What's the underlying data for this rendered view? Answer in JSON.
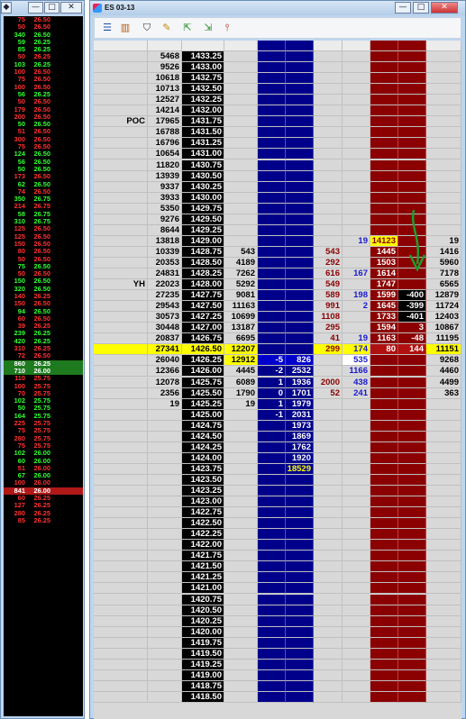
{
  "left_window": {
    "buttons": [
      "—",
      "□",
      "✕"
    ],
    "trades": [
      {
        "q": "75",
        "p": "26.50",
        "c": "#ff3030"
      },
      {
        "q": "50",
        "p": "26.50",
        "c": "#ff3030"
      },
      {
        "q": "340",
        "p": "26.50",
        "c": "#30ff30"
      },
      {
        "q": "59",
        "p": "26.25",
        "c": "#30ff30"
      },
      {
        "q": "85",
        "p": "26.25",
        "c": "#30ff30"
      },
      {
        "q": "50",
        "p": "26.25",
        "c": "#ff3030"
      },
      {
        "q": "103",
        "p": "26.25",
        "c": "#30ff30"
      },
      {
        "q": "100",
        "p": "26.50",
        "c": "#ff3030"
      },
      {
        "q": "75",
        "p": "26.50",
        "c": "#ff3030"
      },
      {
        "q": "100",
        "p": "26.50",
        "c": "#ff3030"
      },
      {
        "q": "56",
        "p": "26.25",
        "c": "#30ff30"
      },
      {
        "q": "50",
        "p": "26.50",
        "c": "#ff3030"
      },
      {
        "q": "179",
        "p": "26.50",
        "c": "#ff3030"
      },
      {
        "q": "200",
        "p": "26.50",
        "c": "#ff3030"
      },
      {
        "q": "50",
        "p": "26.50",
        "c": "#30ff30"
      },
      {
        "q": "51",
        "p": "26.50",
        "c": "#ff3030"
      },
      {
        "q": "300",
        "p": "26.50",
        "c": "#ff3030"
      },
      {
        "q": "75",
        "p": "26.50",
        "c": "#ff3030"
      },
      {
        "q": "124",
        "p": "26.50",
        "c": "#30ff30"
      },
      {
        "q": "56",
        "p": "26.50",
        "c": "#30ff30"
      },
      {
        "q": "50",
        "p": "26.50",
        "c": "#30ff30"
      },
      {
        "q": "173",
        "p": "26.50",
        "c": "#ff3030"
      },
      {
        "q": "62",
        "p": "26.50",
        "c": "#30ff30"
      },
      {
        "q": "74",
        "p": "26.50",
        "c": "#ff3030"
      },
      {
        "q": "350",
        "p": "26.75",
        "c": "#30ff30"
      },
      {
        "q": "214",
        "p": "26.75",
        "c": "#ff3030"
      },
      {
        "q": "58",
        "p": "26.75",
        "c": "#30ff30"
      },
      {
        "q": "310",
        "p": "26.75",
        "c": "#30ff30"
      },
      {
        "q": "125",
        "p": "26.50",
        "c": "#ff3030"
      },
      {
        "q": "125",
        "p": "26.50",
        "c": "#ff3030"
      },
      {
        "q": "150",
        "p": "26.50",
        "c": "#ff3030"
      },
      {
        "q": "80",
        "p": "26.50",
        "c": "#ff3030"
      },
      {
        "q": "50",
        "p": "26.50",
        "c": "#ff3030"
      },
      {
        "q": "75",
        "p": "26.50",
        "c": "#30ff30"
      },
      {
        "q": "50",
        "p": "26.50",
        "c": "#ff3030"
      },
      {
        "q": "150",
        "p": "26.50",
        "c": "#30ff30"
      },
      {
        "q": "320",
        "p": "26.50",
        "c": "#30ff30"
      },
      {
        "q": "140",
        "p": "26.25",
        "c": "#ff3030"
      },
      {
        "q": "150",
        "p": "26.50",
        "c": "#ff3030"
      },
      {
        "q": "94",
        "p": "26.50",
        "c": "#30ff30"
      },
      {
        "q": "60",
        "p": "26.50",
        "c": "#ff3030"
      },
      {
        "q": "39",
        "p": "26.25",
        "c": "#ff3030"
      },
      {
        "q": "239",
        "p": "26.25",
        "c": "#30ff30"
      },
      {
        "q": "420",
        "p": "26.25",
        "c": "#30ff30"
      },
      {
        "q": "310",
        "p": "26.25",
        "c": "#ff3030"
      },
      {
        "q": "72",
        "p": "26.50",
        "c": "#ff3030"
      },
      {
        "q": "860",
        "p": "26.25",
        "c": "#ffffff",
        "bg": "#1e7a1e"
      },
      {
        "q": "710",
        "p": "26.00",
        "c": "#ffffff",
        "bg": "#1e7a1e"
      },
      {
        "q": "110",
        "p": "25.75",
        "c": "#ff3030"
      },
      {
        "q": "100",
        "p": "25.75",
        "c": "#ff3030"
      },
      {
        "q": "70",
        "p": "25.75",
        "c": "#ff3030"
      },
      {
        "q": "102",
        "p": "25.75",
        "c": "#30ff30"
      },
      {
        "q": "50",
        "p": "25.75",
        "c": "#30ff30"
      },
      {
        "q": "164",
        "p": "25.75",
        "c": "#30ff30"
      },
      {
        "q": "225",
        "p": "25.75",
        "c": "#ff3030"
      },
      {
        "q": "75",
        "p": "25.75",
        "c": "#ff3030"
      },
      {
        "q": "280",
        "p": "25.75",
        "c": "#ff3030"
      },
      {
        "q": "75",
        "p": "25.75",
        "c": "#ff3030"
      },
      {
        "q": "102",
        "p": "26.00",
        "c": "#30ff30"
      },
      {
        "q": "60",
        "p": "26.00",
        "c": "#30ff30"
      },
      {
        "q": "51",
        "p": "26.00",
        "c": "#ff3030"
      },
      {
        "q": "67",
        "p": "26.00",
        "c": "#30ff30"
      },
      {
        "q": "100",
        "p": "26.00",
        "c": "#ff3030"
      },
      {
        "q": "841",
        "p": "26.00",
        "c": "#ffffff",
        "bg": "#b01818"
      },
      {
        "q": "60",
        "p": "26.25",
        "c": "#ff3030"
      },
      {
        "q": "127",
        "p": "26.25",
        "c": "#ff3030"
      },
      {
        "q": "280",
        "p": "26.25",
        "c": "#ff3030"
      },
      {
        "q": "85",
        "p": "26.25",
        "c": "#ff3030"
      }
    ]
  },
  "dom_window": {
    "title": "ES 03-13",
    "buttons": [
      "—",
      "□",
      "✕"
    ],
    "toolbar_icons": [
      "list-icon",
      "columns-icon",
      "shield-icon",
      "ruler-icon",
      "export-icon",
      "import-icon",
      "pin-icon"
    ],
    "ladder": [
      {
        "label": "",
        "vol": "5468",
        "price": "1433.25"
      },
      {
        "label": "",
        "vol": "9526",
        "price": "1433.00"
      },
      {
        "label": "",
        "vol": "10618",
        "price": "1432.75"
      },
      {
        "label": "",
        "vol": "10713",
        "price": "1432.50"
      },
      {
        "label": "",
        "vol": "12527",
        "price": "1432.25"
      },
      {
        "label": "",
        "vol": "14214",
        "price": "1432.00"
      },
      {
        "label": "POC",
        "vol": "17965",
        "price": "1431.75"
      },
      {
        "label": "",
        "vol": "16788",
        "price": "1431.50"
      },
      {
        "label": "",
        "vol": "16796",
        "price": "1431.25"
      },
      {
        "label": "",
        "vol": "10654",
        "price": "1431.00"
      },
      {
        "label": "",
        "vol": "11820",
        "price": "1430.75"
      },
      {
        "label": "",
        "vol": "13939",
        "price": "1430.50"
      },
      {
        "label": "",
        "vol": "9337",
        "price": "1430.25"
      },
      {
        "label": "",
        "vol": "3933",
        "price": "1430.00"
      },
      {
        "label": "",
        "vol": "5350",
        "price": "1429.75"
      },
      {
        "label": "",
        "vol": "9276",
        "price": "1429.50"
      },
      {
        "label": "",
        "vol": "8644",
        "price": "1429.25"
      },
      {
        "label": "",
        "vol": "13818",
        "price": "1429.00",
        "c7": "19",
        "c8": "14123",
        "c8y": true,
        "c10": "19"
      },
      {
        "label": "",
        "vol": "10339",
        "price": "1428.75",
        "c3": "543",
        "c6": "543",
        "c8": "1445",
        "c10": "1416"
      },
      {
        "label": "",
        "vol": "20353",
        "price": "1428.50",
        "c3": "4189",
        "c6": "292",
        "c8": "1503",
        "c10": "5960"
      },
      {
        "label": "",
        "vol": "24831",
        "price": "1428.25",
        "c3": "7262",
        "c6": "616",
        "c7": "167",
        "c8": "1614",
        "c10": "7178"
      },
      {
        "label": "YH",
        "vol": "22023",
        "price": "1428.00",
        "c3": "5292",
        "c6": "549",
        "c8": "1747",
        "c10": "6565"
      },
      {
        "label": "",
        "vol": "27235",
        "price": "1427.75",
        "c3": "9081",
        "c6": "589",
        "c7": "198",
        "c8": "1599",
        "c9": "-400",
        "c9k": true,
        "c10": "12879"
      },
      {
        "label": "",
        "vol": "29543",
        "price": "1427.50",
        "c3": "11163",
        "c6": "991",
        "c7": "2",
        "c8": "1645",
        "c9": "-399",
        "c9k": true,
        "c10": "11724"
      },
      {
        "label": "",
        "vol": "30573",
        "price": "1427.25",
        "c3": "10699",
        "c6": "1108",
        "c8": "1733",
        "c9": "-401",
        "c9k": true,
        "c10": "12403"
      },
      {
        "label": "",
        "vol": "30448",
        "price": "1427.00",
        "c3": "13187",
        "c6": "295",
        "c8": "1594",
        "c9": "3",
        "c10": "10867"
      },
      {
        "label": "",
        "vol": "20837",
        "price": "1426.75",
        "c3": "6695",
        "c6": "41",
        "c7": "19",
        "c8": "1163",
        "c9": "-48",
        "c10": "11195"
      },
      {
        "label": "",
        "vol": "27341",
        "price": "1426.50",
        "c3": "12207",
        "c6": "299",
        "c7": "174",
        "c8": "80",
        "c9": "144",
        "c10": "11151",
        "cur": true
      },
      {
        "label": "",
        "vol": "26040",
        "price": "1426.25",
        "c3": "12912",
        "c3y": true,
        "c4": "-5",
        "c5": "826",
        "c7": "535",
        "c10": "9268",
        "c4w": true
      },
      {
        "label": "",
        "vol": "12366",
        "price": "1426.00",
        "c3": "4445",
        "c4": "-2",
        "c5": "2532",
        "c7": "1166",
        "c10": "4460"
      },
      {
        "label": "",
        "vol": "12078",
        "price": "1425.75",
        "c3": "6089",
        "c4": "1",
        "c5": "1936",
        "c6": "2000",
        "c7": "438",
        "c10": "4499"
      },
      {
        "label": "",
        "vol": "2356",
        "price": "1425.50",
        "c3": "1790",
        "c4": "0",
        "c5": "1701",
        "c6": "52",
        "c7": "241",
        "c10": "363"
      },
      {
        "label": "",
        "vol": "19",
        "price": "1425.25",
        "c3": "19",
        "c4": "1",
        "c5": "1979"
      },
      {
        "label": "",
        "vol": "",
        "price": "1425.00",
        "c4": "-1",
        "c5": "2031"
      },
      {
        "label": "",
        "vol": "",
        "price": "1424.75",
        "c5": "1973"
      },
      {
        "label": "",
        "vol": "",
        "price": "1424.50",
        "c5": "1869"
      },
      {
        "label": "",
        "vol": "",
        "price": "1424.25",
        "c5": "1762"
      },
      {
        "label": "",
        "vol": "",
        "price": "1424.00",
        "c5": "1920"
      },
      {
        "label": "",
        "vol": "",
        "price": "1423.75",
        "c5": "18529",
        "c5y": true
      },
      {
        "label": "",
        "vol": "",
        "price": "1423.50"
      },
      {
        "label": "",
        "vol": "",
        "price": "1423.25"
      },
      {
        "label": "",
        "vol": "",
        "price": "1423.00"
      },
      {
        "label": "",
        "vol": "",
        "price": "1422.75"
      },
      {
        "label": "",
        "vol": "",
        "price": "1422.50"
      },
      {
        "label": "",
        "vol": "",
        "price": "1422.25"
      },
      {
        "label": "",
        "vol": "",
        "price": "1422.00"
      },
      {
        "label": "",
        "vol": "",
        "price": "1421.75"
      },
      {
        "label": "",
        "vol": "",
        "price": "1421.50"
      },
      {
        "label": "",
        "vol": "",
        "price": "1421.25"
      },
      {
        "label": "",
        "vol": "",
        "price": "1421.00"
      },
      {
        "label": "",
        "vol": "",
        "price": "1420.75"
      },
      {
        "label": "",
        "vol": "",
        "price": "1420.50"
      },
      {
        "label": "",
        "vol": "",
        "price": "1420.25"
      },
      {
        "label": "",
        "vol": "",
        "price": "1420.00"
      },
      {
        "label": "",
        "vol": "",
        "price": "1419.75"
      },
      {
        "label": "",
        "vol": "",
        "price": "1419.50"
      },
      {
        "label": "",
        "vol": "",
        "price": "1419.25"
      },
      {
        "label": "",
        "vol": "",
        "price": "1419.00"
      },
      {
        "label": "",
        "vol": "",
        "price": "1418.75"
      },
      {
        "label": "",
        "vol": "",
        "price": "1418.50"
      }
    ]
  },
  "colors": {
    "bid_col": "#00008b",
    "ask_col": "#8b0000",
    "current_row": "#ffff00",
    "green_arrow": "#1e9e2e"
  }
}
